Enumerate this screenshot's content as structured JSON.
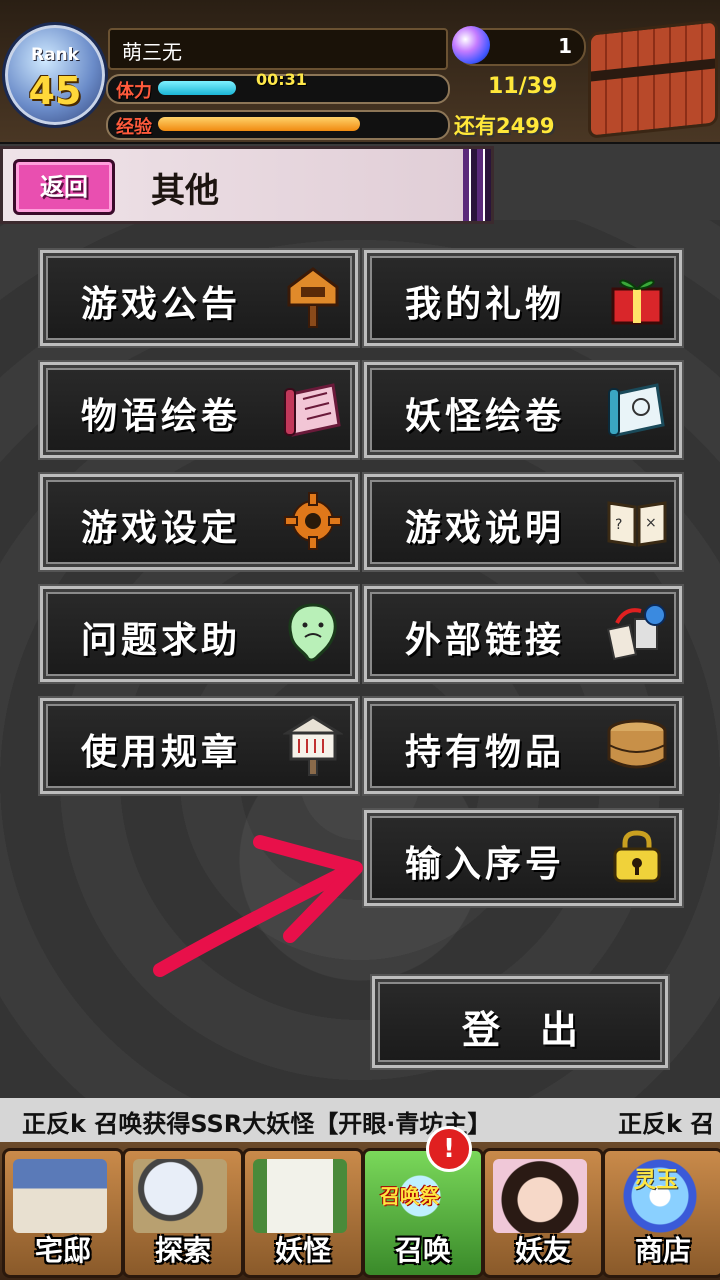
{
  "header": {
    "rank_label": "Rank",
    "rank_value": "45",
    "player_name": "萌三无",
    "stamina_label": "体力",
    "stamina_timer": "00:31",
    "stamina_count": "11/39",
    "stamina_fill_fraction": 0.28,
    "exp_label": "经验",
    "exp_remaining": "还有2499",
    "exp_fill_fraction": 0.72,
    "gem_count": "1"
  },
  "titlebar": {
    "back_label": "返回",
    "title": "其他"
  },
  "menu": {
    "announcements": "游戏公告",
    "gifts": "我的礼物",
    "story_scroll": "物语绘卷",
    "yokai_scroll": "妖怪绘卷",
    "settings": "游戏设定",
    "instructions": "游戏说明",
    "help": "问题求助",
    "external_links": "外部链接",
    "rules": "使用规章",
    "items": "持有物品",
    "serial_code": "输入序号",
    "logout": "登出"
  },
  "ticker": {
    "message": "正反k 召唤获得SSR大妖怪【开眼·青坊主】",
    "message_tail": "正反k 召"
  },
  "nav": {
    "home": "宅邸",
    "explore": "探索",
    "yokai": "妖怪",
    "summon": "召唤",
    "summon_festival": "召唤祭",
    "summon_badge": "!",
    "friends": "妖友",
    "shop": "商店",
    "shop_coin": "灵玉"
  },
  "colors": {
    "back_button": "#e94fb0",
    "accent_yellow": "#ffe83a",
    "stamina_bar": "#1bb6d6",
    "exp_bar": "#f08a10",
    "annotation_arrow": "#e8104a"
  }
}
